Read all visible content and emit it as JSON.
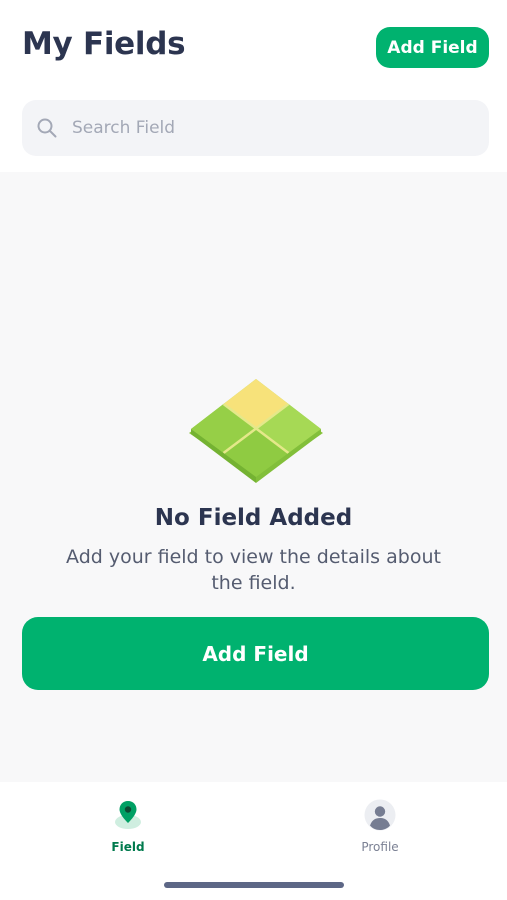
{
  "header": {
    "title": "My Fields",
    "add_field_label": "Add Field"
  },
  "search": {
    "placeholder": "Search Field",
    "value": ""
  },
  "empty_state": {
    "title": "No Field Added",
    "description": "Add your field to view the details about the field.",
    "button_label": "Add Field"
  },
  "bottom_nav": {
    "items": [
      {
        "label": "Field",
        "icon": "map-pin-icon",
        "active": true
      },
      {
        "label": "Profile",
        "icon": "user-avatar-icon",
        "active": false
      }
    ]
  },
  "colors": {
    "accent": "#00b26f",
    "active_nav": "#007a4d",
    "title": "#2c3550",
    "background": "#f8f8f9"
  }
}
